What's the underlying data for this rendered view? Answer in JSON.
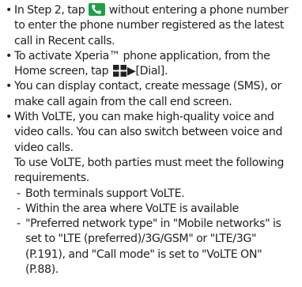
{
  "notes": {
    "step2": {
      "before_icon": "In Step 2, tap ",
      "after_icon": " without entering a phone number to enter the phone number registered as the latest call in Recent calls."
    },
    "activate": {
      "before_icon": "To activate Xperia™ phone application, from the Home screen, tap ",
      "after_icon": "▶[Dial]."
    },
    "call_end": {
      "text": "You can display contact, create message (SMS), or make call again from the call end screen."
    },
    "volte": {
      "text": "With VoLTE, you can make high-quality voice and video calls. You can also switch between voice and video calls.",
      "requirements_intro": "To use VoLTE, both parties must meet the following requirements.",
      "requirements": [
        "Both terminals support VoLTE.",
        "Within the area where VoLTE is available",
        "\"Preferred network type\" in \"Mobile networks\" is set to \"LTE (preferred)/3G/GSM\" or \"LTE/3G\" (P.191), and \"Call mode\" is set to \"VoLTE ON\" (P.88)."
      ]
    }
  },
  "symbols": {
    "bullet": "•",
    "dash": "-"
  },
  "icons": {
    "call": "phone-call-icon",
    "apps": "app-grid-icon"
  },
  "colors": {
    "call_icon_bg": "#1e9f46",
    "apps_icon": "#222222"
  }
}
